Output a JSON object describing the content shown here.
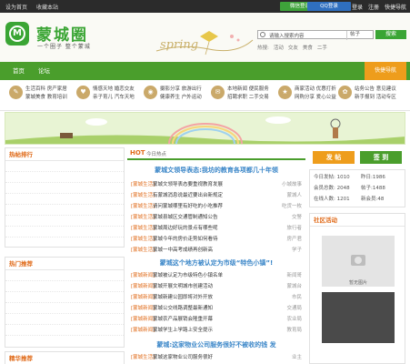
{
  "topbar": {
    "links": [
      "设为首页",
      "收藏本站"
    ],
    "wechat_login": "微信登录",
    "qq_login": "QQ登录",
    "right_links": [
      "登录",
      "注册",
      "快捷导航"
    ]
  },
  "header": {
    "logo_letter": "M",
    "site_title": "蒙城圈",
    "slogan": "一个圈子 整个蒙城",
    "spring_text": "spring",
    "search": {
      "placeholder": "请输入搜索内容",
      "scope": "帖子",
      "button": "搜索"
    },
    "hotwords": [
      "热搜:",
      "活动",
      "交友",
      "美食",
      "二手"
    ]
  },
  "nav": {
    "items": [
      "首页",
      "论坛"
    ],
    "quick_nav": "快捷导航"
  },
  "categories": [
    {
      "icon": "book-icon",
      "links": [
        "生活百科",
        "房产家居",
        "蒙城美食",
        "教育培训"
      ]
    },
    {
      "icon": "heart-icon",
      "links": [
        "情感天地",
        "婚恋交友",
        "亲子育儿",
        "汽车天地"
      ]
    },
    {
      "icon": "camera-icon",
      "links": [
        "摄影分享",
        "旅游出行",
        "健康养生",
        "户外运动"
      ]
    },
    {
      "icon": "chat-icon",
      "links": [
        "本地新闻",
        "便民服务",
        "招聘求职",
        "二手交易"
      ]
    },
    {
      "icon": "star-icon",
      "links": [
        "商家活动",
        "优惠打折",
        "网购分享",
        "爱心公益"
      ]
    },
    {
      "icon": "gift-icon",
      "links": [
        "站务公告",
        "意见建议",
        "新手报到",
        "活动专区"
      ]
    }
  ],
  "left": {
    "hot_title": "热帖排行",
    "hot_rows": [
      "",
      "",
      "",
      "",
      "",
      "",
      "",
      ""
    ],
    "rec_title": "热门推荐",
    "rec_rows": [
      "",
      "",
      "",
      "",
      "",
      "",
      ""
    ],
    "more_title": "精华推荐"
  },
  "center": {
    "hot_label": "HOT",
    "hot_sub": "今日热点",
    "headlines": [
      "蒙城文领导表态:我坊的教育各项都几十年领",
      "蒙城这个地方被认定为市级“特色小镇”!",
      "蒙城:这家物业公司服务很好不被收的钱 发"
    ],
    "news_groups": [
      [
        {
          "tag": "[蒙城生活]",
          "title": "蒙城文领导表态要重视教育发展",
          "author": "小城故事"
        },
        {
          "tag": "[蒙城生活]",
          "title": "有蒙城消息说最近要出台新规定",
          "author": "蒙城人"
        },
        {
          "tag": "[蒙城生活]",
          "title": "请问蒙城哪里有好吃的小吃推荐",
          "author": "吃货一枚"
        },
        {
          "tag": "[蒙城生活]",
          "title": "蒙城县城区交通管制通知公告",
          "author": "交警"
        },
        {
          "tag": "[蒙城生活]",
          "title": "蒙城周边好玩的景点有哪些呢",
          "author": "旅行者"
        },
        {
          "tag": "[蒙城生活]",
          "title": "蒙城今年的房价走势如何看待",
          "author": "房产君"
        },
        {
          "tag": "[蒙城生活]",
          "title": "蒙城一中高考成绩再创新高",
          "author": "学子"
        }
      ],
      [
        {
          "tag": "[蒙城新闻]",
          "title": "蒙城被认定为市级特色小镇名单",
          "author": "新闻哥"
        },
        {
          "tag": "[蒙城新闻]",
          "title": "蒙城开展文明城市创建活动",
          "author": "蒙城台"
        },
        {
          "tag": "[蒙城新闻]",
          "title": "蒙城新建公园即将对外开放",
          "author": "市民"
        },
        {
          "tag": "[蒙城新闻]",
          "title": "蒙城公交线路调整最新通知",
          "author": "交通局"
        },
        {
          "tag": "[蒙城新闻]",
          "title": "蒙城农产品展销会隆重开幕",
          "author": "农业局"
        },
        {
          "tag": "[蒙城新闻]",
          "title": "蒙城学生上学路上安全提示",
          "author": "教育局"
        }
      ],
      [
        {
          "tag": "[蒙城生活]",
          "title": "蒙城这家物业公司服务很好",
          "author": "业主"
        }
      ]
    ]
  },
  "right": {
    "post_button": "发 帖",
    "signin_button": "签 到",
    "stats": [
      {
        "a": "今日发帖: 1010",
        "b": "昨日:1986"
      },
      {
        "a": "会员总数: 2048",
        "b": "帖子:1488"
      },
      {
        "a": "在线人数: 1201",
        "b": "新会员:48"
      }
    ],
    "community_title": "社区活动",
    "photo_caption": "暂无图片"
  },
  "colors": {
    "brand_green": "#3aa534",
    "nav_green": "#4a9e2c",
    "accent_orange": "#e06b1a",
    "quick_orange": "#ee9d1c",
    "headline_blue": "#3a86c8"
  }
}
